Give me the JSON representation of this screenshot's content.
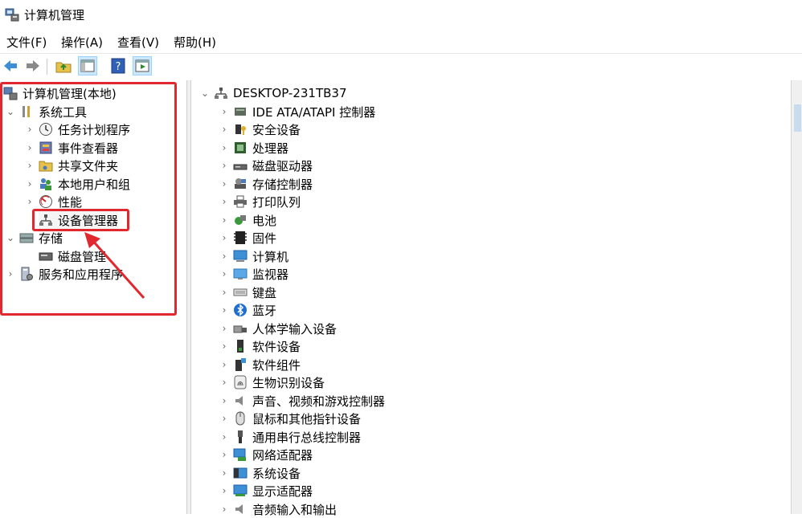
{
  "window": {
    "title": "计算机管理"
  },
  "menu": [
    "文件(F)",
    "操作(A)",
    "查看(V)",
    "帮助(H)"
  ],
  "toolbar": [
    "back-icon",
    "forward-icon",
    "folder-up-icon",
    "show-hide-console-tree-icon",
    "help-icon",
    "show-hide-action-pane-icon"
  ],
  "left_tree": {
    "root": "计算机管理(本地)",
    "system_tools": "系统工具",
    "task_scheduler": "任务计划程序",
    "event_viewer": "事件查看器",
    "shared_folders": "共享文件夹",
    "local_users": "本地用户和组",
    "performance": "性能",
    "device_manager": "设备管理器",
    "storage": "存储",
    "disk_management": "磁盘管理",
    "services_apps": "服务和应用程序"
  },
  "right_tree": {
    "computer": "DESKTOP-231TB37",
    "items": [
      "IDE ATA/ATAPI 控制器",
      "安全设备",
      "处理器",
      "磁盘驱动器",
      "存储控制器",
      "打印队列",
      "电池",
      "固件",
      "计算机",
      "监视器",
      "键盘",
      "蓝牙",
      "人体学输入设备",
      "软件设备",
      "软件组件",
      "生物识别设备",
      "声音、视频和游戏控制器",
      "鼠标和其他指针设备",
      "通用串行总线控制器",
      "网络适配器",
      "系统设备",
      "显示适配器",
      "音频输入和输出"
    ]
  },
  "colors": {
    "annotation_red": "#e0282e",
    "selection_blue": "#cce8ff"
  }
}
